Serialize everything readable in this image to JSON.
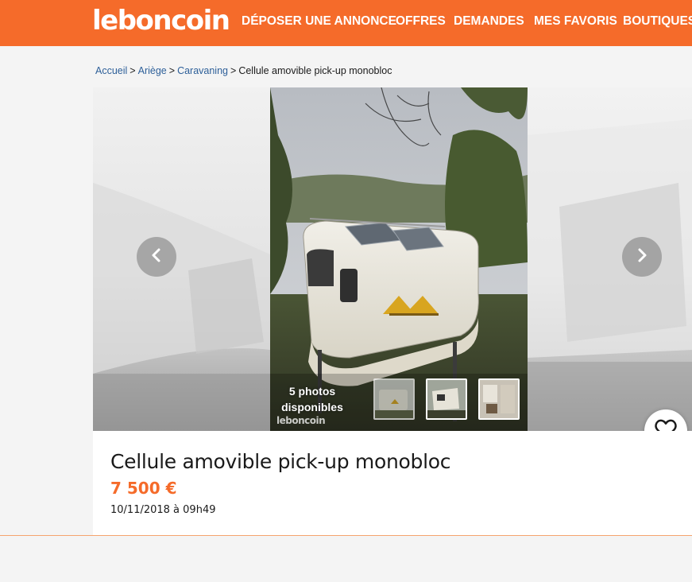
{
  "header": {
    "logo": "leboncoin",
    "nav": [
      {
        "label": "DÉPOSER UNE ANNONCE"
      },
      {
        "label": "OFFRES"
      },
      {
        "label": "DEMANDES"
      },
      {
        "label": "MES FAVORIS"
      },
      {
        "label": "BOUTIQUES"
      }
    ],
    "brand_color": "#f56b2a"
  },
  "breadcrumb": {
    "items": [
      {
        "label": "Accueil"
      },
      {
        "label": "Ariège"
      },
      {
        "label": "Caravaning"
      }
    ],
    "separator": ">",
    "current": "Cellule amovible pick-up monobloc"
  },
  "gallery": {
    "photos_count_line1": "5 photos",
    "photos_count_line2": "disponibles",
    "watermark": "leboncoin",
    "prev_icon": "chevron-left-icon",
    "next_icon": "chevron-right-icon"
  },
  "ad": {
    "title": "Cellule amovible pick-up monobloc",
    "price": "7 500 €",
    "date": "10/11/2018 à 09h49",
    "favorite_icon": "heart-icon"
  }
}
